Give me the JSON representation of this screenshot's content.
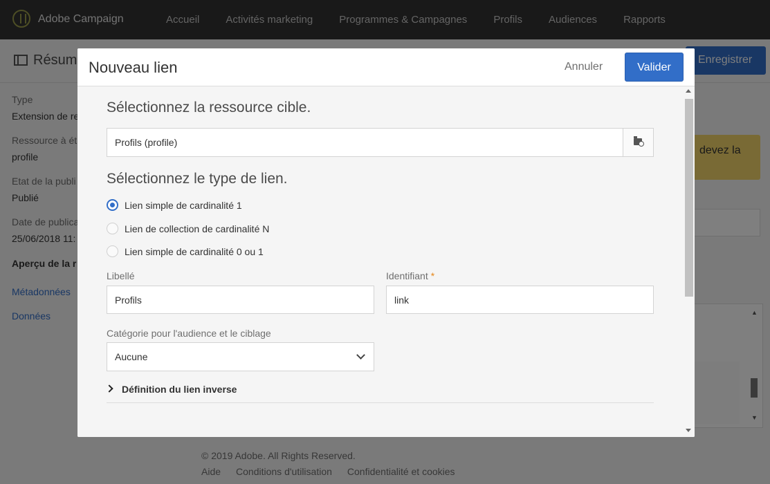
{
  "topbar": {
    "brand": "Adobe Campaign",
    "nav": [
      "Accueil",
      "Activités marketing",
      "Programmes & Campagnes",
      "Profils",
      "Audiences",
      "Rapports"
    ]
  },
  "page": {
    "title": "Résum",
    "save_label": "Enregistrer"
  },
  "sidebar": {
    "type_label": "Type",
    "type_value": "Extension de re",
    "resource_label": "Ressource à ét",
    "resource_value": "profile",
    "state_label": "Etat de la publi",
    "state_value": "Publié",
    "date_label": "Date de publica",
    "date_value": "25/06/2018 11:",
    "preview_label": "Aperçu de la r",
    "links": [
      "Métadonnées",
      "Données"
    ]
  },
  "content": {
    "warning_text": "devez la",
    "footer_copy": "© 2019 Adobe. All Rights Reserved.",
    "footer_links": [
      "Aide",
      "Conditions d'utilisation",
      "Confidentialité et cookies"
    ]
  },
  "dialog": {
    "title": "Nouveau lien",
    "cancel_label": "Annuler",
    "ok_label": "Valider",
    "target_section_title": "Sélectionnez la ressource cible.",
    "target_resource_value": "Profils (profile)",
    "link_type_section_title": "Sélectionnez le type de lien.",
    "link_types": [
      {
        "label": "Lien simple de cardinalité 1",
        "checked": true
      },
      {
        "label": "Lien de collection de cardinalité N",
        "checked": false
      },
      {
        "label": "Lien simple de cardinalité 0 ou 1",
        "checked": false
      }
    ],
    "label_field_label": "Libellé",
    "label_field_value": "Profils",
    "id_field_label": "Identifiant",
    "id_required_mark": "*",
    "id_field_value": "link",
    "category_label": "Catégorie pour l'audience et le ciblage",
    "category_value": "Aucune",
    "inverse_section_label": "Définition du lien inverse"
  },
  "colors": {
    "accent": "#326ec8",
    "topbar": "#323232",
    "warning": "#f3d46b",
    "required": "#e68619"
  }
}
